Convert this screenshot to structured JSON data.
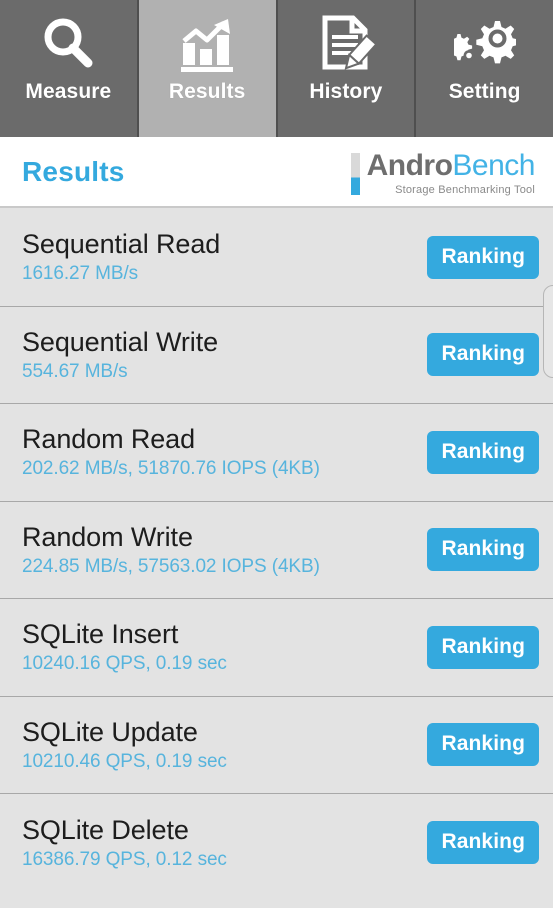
{
  "tabs": [
    {
      "id": "measure",
      "label": "Measure",
      "icon": "magnifier-icon",
      "active": false
    },
    {
      "id": "results",
      "label": "Results",
      "icon": "bar-chart-trend-icon",
      "active": true
    },
    {
      "id": "history",
      "label": "History",
      "icon": "document-pencil-icon",
      "active": false
    },
    {
      "id": "setting",
      "label": "Setting",
      "icon": "gears-icon",
      "active": false
    }
  ],
  "header": {
    "title": "Results",
    "logo": {
      "name_primary": "Andro",
      "name_secondary": "Bench",
      "tagline": "Storage Benchmarking Tool"
    }
  },
  "colors": {
    "accent_blue": "#34a9de",
    "sub_text_blue": "#57b4dd",
    "tab_inactive": "#6b6b6b",
    "tab_active": "#b1b1b1",
    "row_background": "#e3e3e3",
    "row_divider": "#a8a8a8",
    "logo_gray": "#6e6e6e"
  },
  "results": [
    {
      "name": "Sequential Read",
      "value": "1616.27 MB/s",
      "action": "Ranking"
    },
    {
      "name": "Sequential Write",
      "value": "554.67 MB/s",
      "action": "Ranking"
    },
    {
      "name": "Random Read",
      "value": "202.62 MB/s, 51870.76 IOPS (4KB)",
      "action": "Ranking"
    },
    {
      "name": "Random Write",
      "value": "224.85 MB/s, 57563.02 IOPS (4KB)",
      "action": "Ranking"
    },
    {
      "name": "SQLite Insert",
      "value": "10240.16 QPS, 0.19 sec",
      "action": "Ranking"
    },
    {
      "name": "SQLite Update",
      "value": "10210.46 QPS, 0.19 sec",
      "action": "Ranking"
    },
    {
      "name": "SQLite Delete",
      "value": "16386.79 QPS, 0.12 sec",
      "action": "Ranking"
    }
  ]
}
